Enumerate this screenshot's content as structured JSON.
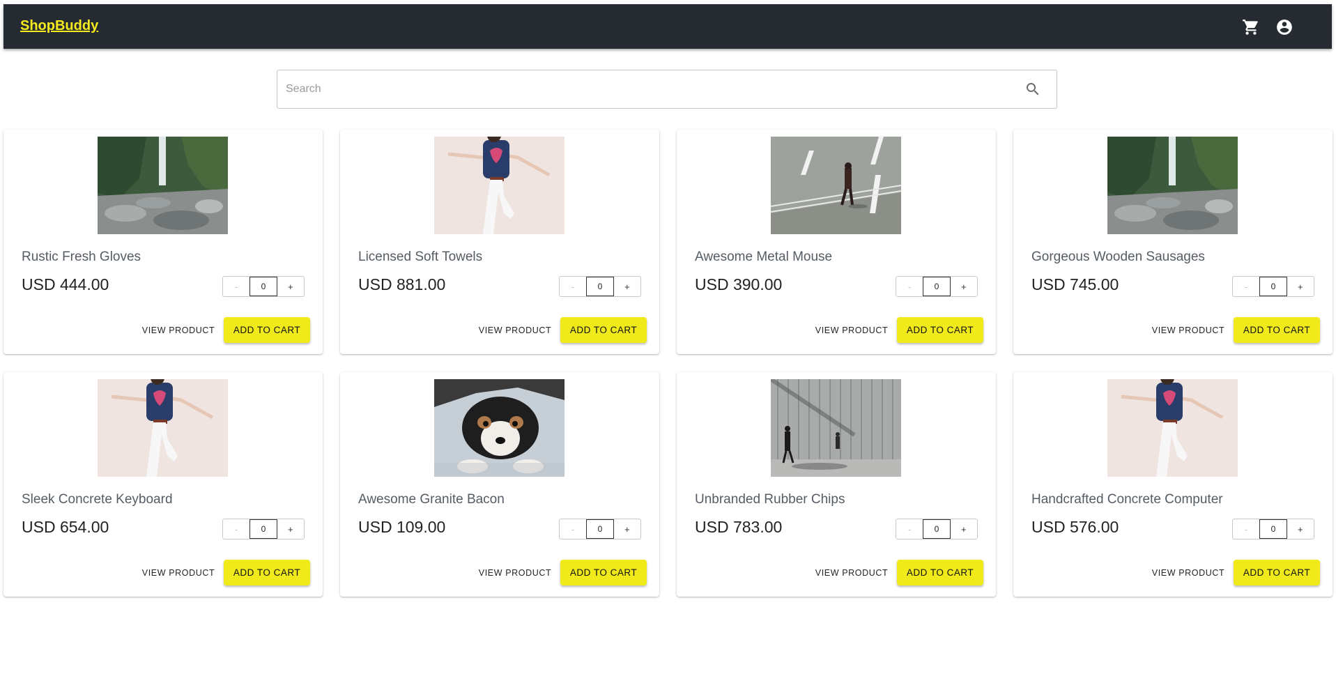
{
  "header": {
    "brand": "ShopBuddy",
    "icons": [
      "cart-icon",
      "account-icon"
    ],
    "background_color": "#262b31",
    "brand_color": "#f3eb1e"
  },
  "search": {
    "placeholder": "Search",
    "value": ""
  },
  "product_action_labels": {
    "view": "VIEW PRODUCT",
    "add": "ADD TO CART",
    "minus": "-",
    "plus": "+"
  },
  "accent_color": "#f0ea1a",
  "products": [
    {
      "name": "Rustic Fresh Gloves",
      "price": "USD 444.00",
      "quantity": "0",
      "image": "waterfall"
    },
    {
      "name": "Licensed Soft Towels",
      "price": "USD 881.00",
      "quantity": "0",
      "image": "jumping-woman"
    },
    {
      "name": "Awesome Metal Mouse",
      "price": "USD 390.00",
      "quantity": "0",
      "image": "man-on-road"
    },
    {
      "name": "Gorgeous Wooden Sausages",
      "price": "USD 745.00",
      "quantity": "0",
      "image": "waterfall"
    },
    {
      "name": "Sleek Concrete Keyboard",
      "price": "USD 654.00",
      "quantity": "0",
      "image": "jumping-woman"
    },
    {
      "name": "Awesome Granite Bacon",
      "price": "USD 109.00",
      "quantity": "0",
      "image": "puppy"
    },
    {
      "name": "Unbranded Rubber Chips",
      "price": "USD 783.00",
      "quantity": "0",
      "image": "people-by-wall"
    },
    {
      "name": "Handcrafted Concrete Computer",
      "price": "USD 576.00",
      "quantity": "0",
      "image": "jumping-woman"
    }
  ]
}
